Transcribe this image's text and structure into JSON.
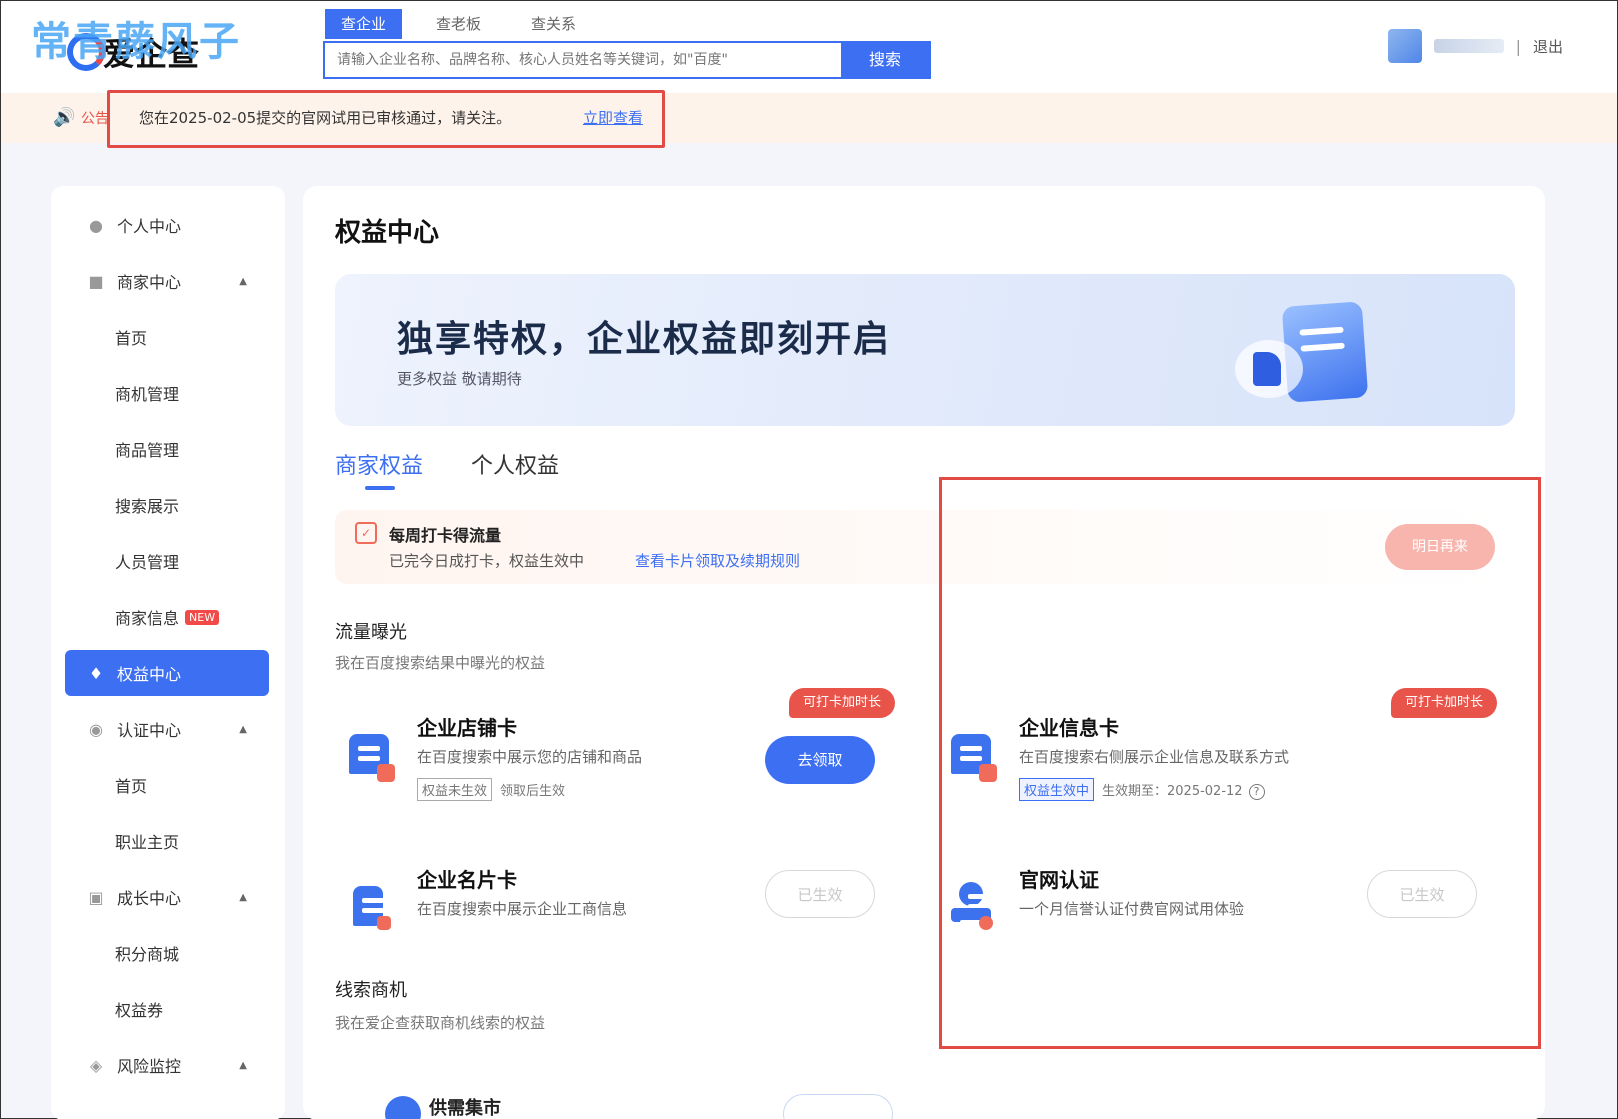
{
  "header": {
    "watermark": "常青藤风子",
    "logo_text": "爱企查",
    "search_tabs": [
      "查企业",
      "查老板",
      "查关系"
    ],
    "search_placeholder": "请输入企业名称、品牌名称、核心人员姓名等关键词，如\"百度\"",
    "search_button": "搜索",
    "separator": "|",
    "logout": "退出"
  },
  "notice": {
    "label": "公告",
    "text": "您在2025-02-05提交的官网试用已审核通过，请关注。",
    "link": "立即查看"
  },
  "sidebar": {
    "items": [
      {
        "label": "个人中心",
        "icon": "user-icon"
      },
      {
        "label": "商家中心",
        "icon": "store-icon",
        "caret": "▲"
      },
      {
        "label": "首页"
      },
      {
        "label": "商机管理"
      },
      {
        "label": "商品管理"
      },
      {
        "label": "搜索展示"
      },
      {
        "label": "人员管理"
      },
      {
        "label": "商家信息",
        "badge": "NEW"
      },
      {
        "label": "权益中心",
        "icon": "diamond-icon",
        "active": true
      },
      {
        "label": "认证中心",
        "icon": "shield-check-icon",
        "caret": "▲"
      },
      {
        "label": "首页"
      },
      {
        "label": "职业主页"
      },
      {
        "label": "成长中心",
        "icon": "growth-icon",
        "caret": "▲"
      },
      {
        "label": "积分商城"
      },
      {
        "label": "权益券"
      },
      {
        "label": "风险监控",
        "icon": "shield-icon",
        "caret": "▲"
      }
    ]
  },
  "main": {
    "title": "权益中心",
    "banner": {
      "heading": "独享特权，企业权益即刻开启",
      "sub": "更多权益 敬请期待"
    },
    "tabs": [
      "商家权益",
      "个人权益"
    ],
    "checkin": {
      "title": "每周打卡得流量",
      "desc": "已完今日成打卡，权益生效中",
      "link": "查看卡片领取及续期规则",
      "button": "明日再来"
    },
    "section1": {
      "title": "流量曝光",
      "sub": "我在百度搜索结果中曝光的权益"
    },
    "cards": [
      {
        "title": "企业店铺卡",
        "desc": "在百度搜索中展示您的店铺和商品",
        "tag": "权益未生效",
        "status": "领取后生效",
        "ribbon": "可打卡加时长",
        "button": "去领取"
      },
      {
        "title": "企业信息卡",
        "desc": "在百度搜索右侧展示企业信息及联系方式",
        "tag": "权益生效中",
        "status": "生效期至：2025-02-12",
        "ribbon": "可打卡加时长"
      },
      {
        "title": "企业名片卡",
        "desc": "在百度搜索中展示企业工商信息",
        "button": "已生效"
      },
      {
        "title": "官网认证",
        "desc": "一个月信誉认证付费官网试用体验",
        "button": "已生效"
      }
    ],
    "section2": {
      "title": "线索商机",
      "sub": "我在爱企查获取商机线索的权益"
    },
    "partial_card_title": "供需集市"
  },
  "colors": {
    "accent": "#3d6ff2",
    "alert": "#e24a44"
  }
}
